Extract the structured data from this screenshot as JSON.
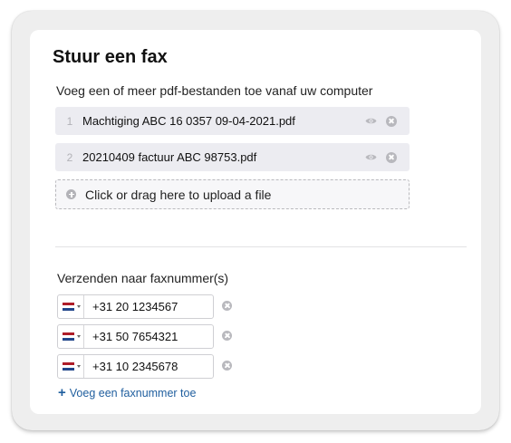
{
  "form": {
    "title": "Stuur een fax",
    "files_instruction": "Voeg een of meer pdf-bestanden toe vanaf uw computer",
    "files": [
      {
        "index": "1",
        "name": "Machtiging ABC 16 0357 09-04-2021.pdf",
        "icon_view": "eye-icon",
        "icon_remove": "close-circle-icon"
      },
      {
        "index": "2",
        "name": "20210409 factuur ABC 98753.pdf",
        "icon_view": "eye-icon",
        "icon_remove": "close-circle-icon"
      }
    ],
    "upload_label": "Click or drag here to upload a file",
    "fax_label": "Verzenden naar faxnummer(s)",
    "fax_numbers": [
      {
        "country_flag": "netherlands-flag",
        "number": "+31 20 1234567"
      },
      {
        "country_flag": "netherlands-flag",
        "number": "+31 50 7654321"
      },
      {
        "country_flag": "netherlands-flag",
        "number": "+31 10 2345678"
      }
    ],
    "add_fax_label": "Voeg een faxnummer toe"
  },
  "colors": {
    "link": "#1f5e9e",
    "file_row_bg": "#ececf1",
    "flag_red": "#ae1c28",
    "flag_white": "#ffffff",
    "flag_blue": "#21468b"
  }
}
